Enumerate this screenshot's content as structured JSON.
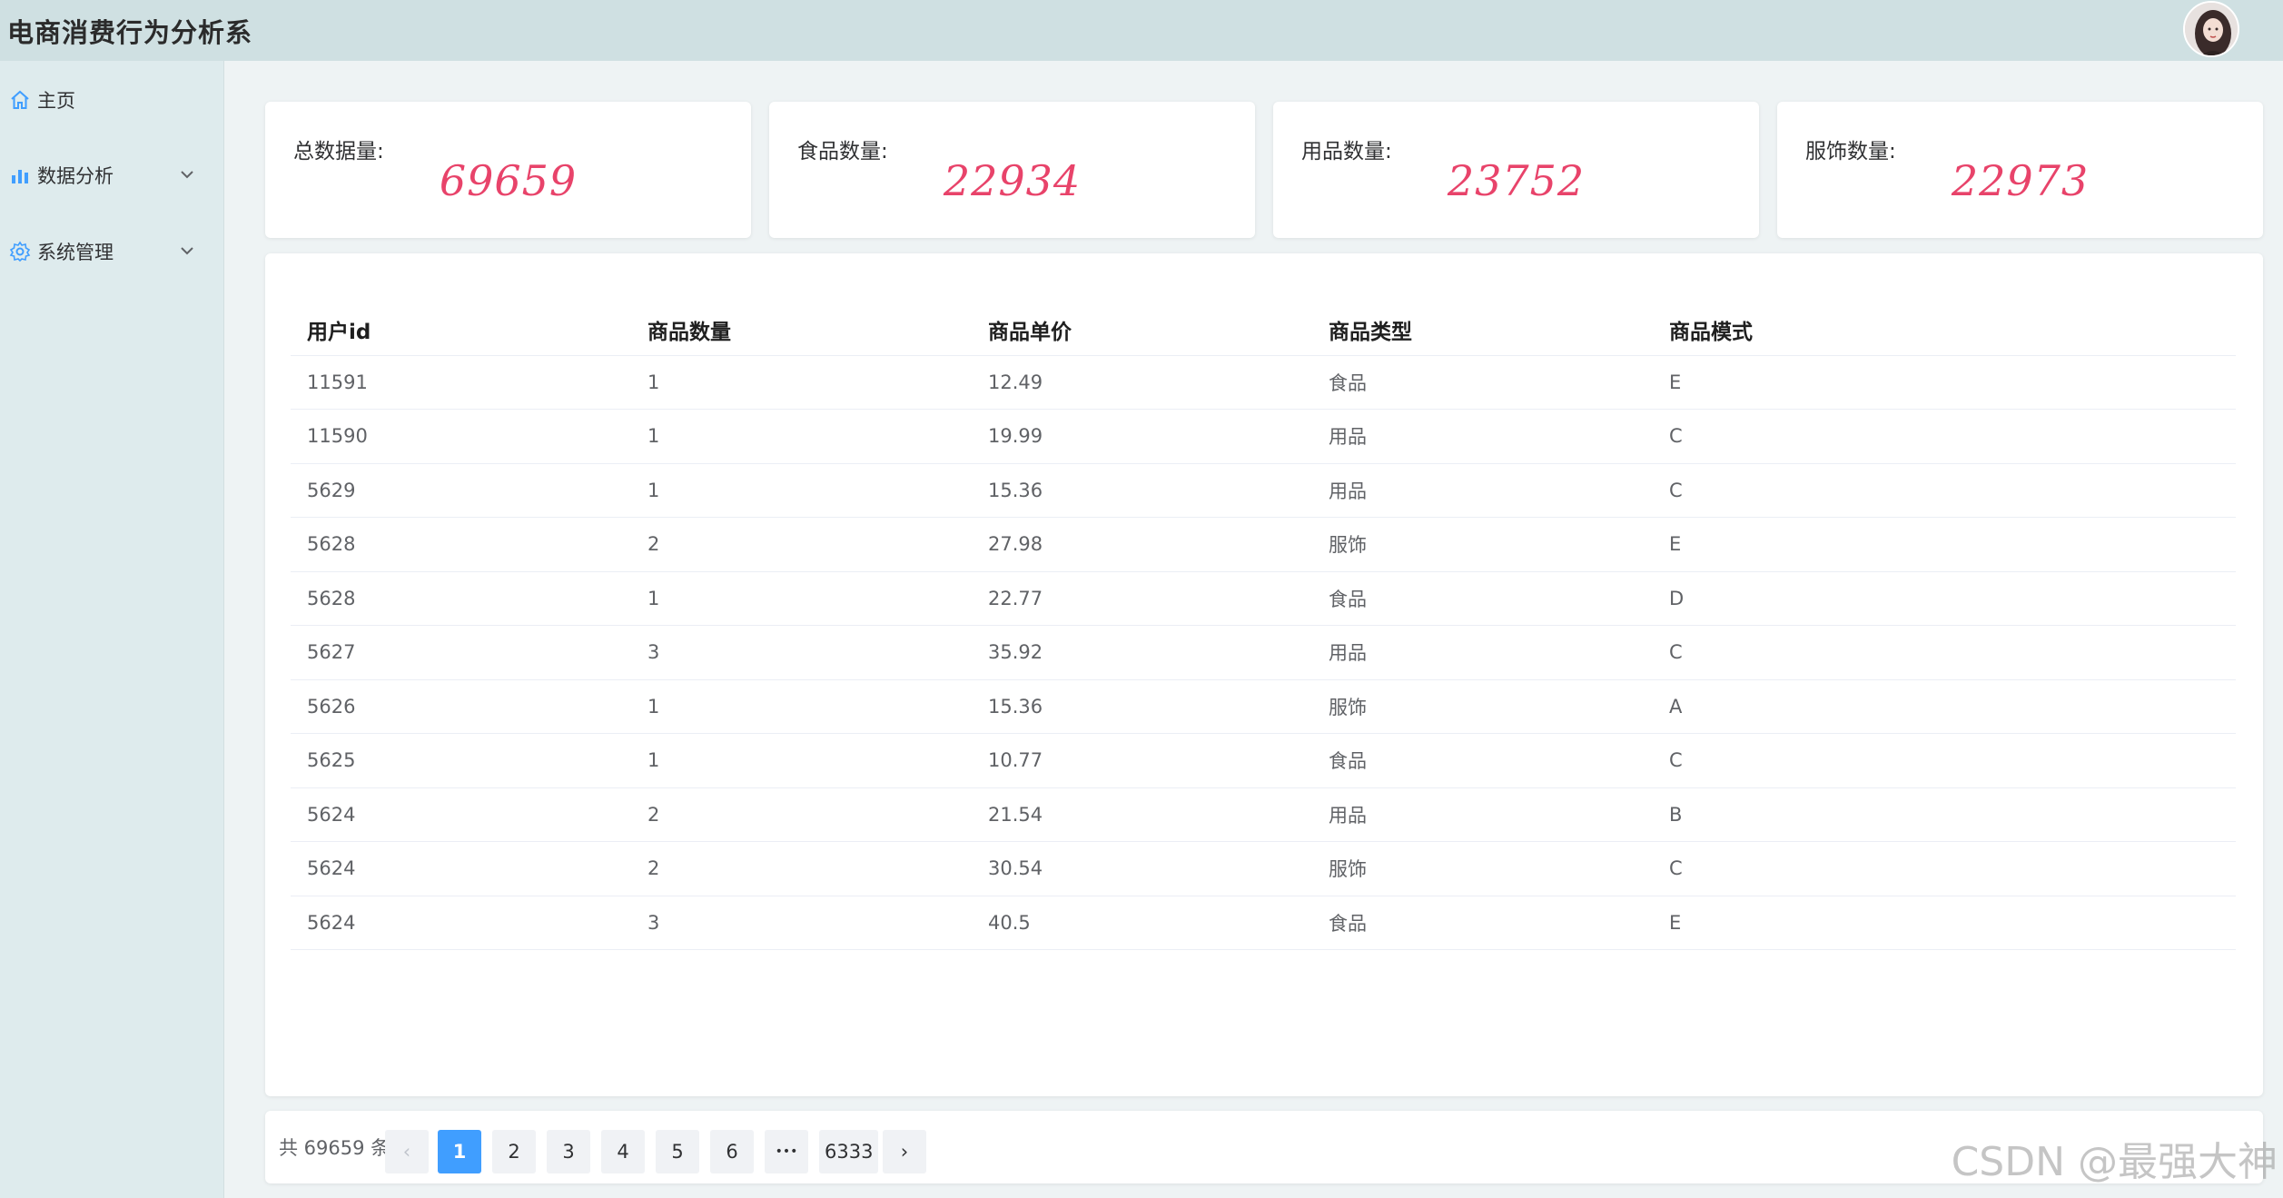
{
  "app": {
    "title": "电商消费行为分析系"
  },
  "sidebar": {
    "items": [
      {
        "label": "主页",
        "icon": "home-icon"
      },
      {
        "label": "数据分析",
        "icon": "bar-chart-icon",
        "expandable": true
      },
      {
        "label": "系统管理",
        "icon": "gear-icon",
        "expandable": true
      }
    ]
  },
  "stats": [
    {
      "label": "总数据量:",
      "value": "69659"
    },
    {
      "label": "食品数量:",
      "value": "22934"
    },
    {
      "label": "用品数量:",
      "value": "23752"
    },
    {
      "label": "服饰数量:",
      "value": "22973"
    }
  ],
  "table": {
    "headers": [
      "用户id",
      "商品数量",
      "商品单价",
      "商品类型",
      "商品模式"
    ],
    "rows": [
      [
        "11591",
        "1",
        "12.49",
        "食品",
        "E"
      ],
      [
        "11590",
        "1",
        "19.99",
        "用品",
        "C"
      ],
      [
        "5629",
        "1",
        "15.36",
        "用品",
        "C"
      ],
      [
        "5628",
        "2",
        "27.98",
        "服饰",
        "E"
      ],
      [
        "5628",
        "1",
        "22.77",
        "食品",
        "D"
      ],
      [
        "5627",
        "3",
        "35.92",
        "用品",
        "C"
      ],
      [
        "5626",
        "1",
        "15.36",
        "服饰",
        "A"
      ],
      [
        "5625",
        "1",
        "10.77",
        "食品",
        "C"
      ],
      [
        "5624",
        "2",
        "21.54",
        "用品",
        "B"
      ],
      [
        "5624",
        "2",
        "30.54",
        "服饰",
        "C"
      ],
      [
        "5624",
        "3",
        "40.5",
        "食品",
        "E"
      ]
    ]
  },
  "pagination": {
    "total_text": "共 69659 条",
    "prev": "‹",
    "pages": [
      "1",
      "2",
      "3",
      "4",
      "5",
      "6"
    ],
    "ellipsis": "•••",
    "last": "6333",
    "next": "›",
    "current": "1"
  },
  "watermark": "CSDN @最强大神",
  "colors": {
    "accent": "#409eff",
    "stat_value": "#e8436a",
    "topbar": "#cfe0e2",
    "sidebar": "#deebed"
  }
}
